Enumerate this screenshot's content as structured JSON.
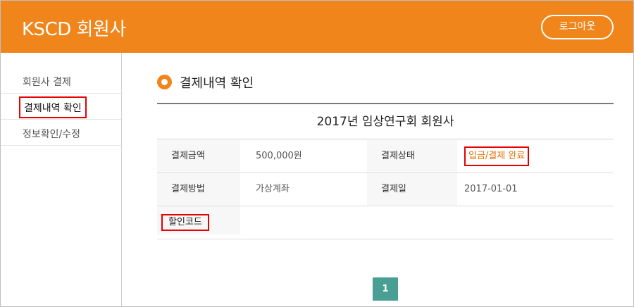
{
  "header": {
    "brand": "KSCD 회원사",
    "logout_label": "로그아웃",
    "accent_color": "#f0851c"
  },
  "sidebar": {
    "items": [
      {
        "label": "회원사 결제",
        "active": false
      },
      {
        "label": "결제내역 확인",
        "active": true
      },
      {
        "label": "정보확인/수정",
        "active": false
      }
    ]
  },
  "main": {
    "section_title": "결제내역 확인",
    "table_title": "2017년 임상연구회 회원사",
    "rows": [
      {
        "label1": "결제금액",
        "value1": "500,000원",
        "label2": "결제상태",
        "value2": "입금/결제 완료"
      },
      {
        "label1": "결제방법",
        "value1": "가상계좌",
        "label2": "결제일",
        "value2": "2017-01-01"
      },
      {
        "label1": "할인코드",
        "value1": ""
      }
    ]
  },
  "pagination": {
    "current_page": "1",
    "color": "#4a9f94"
  }
}
